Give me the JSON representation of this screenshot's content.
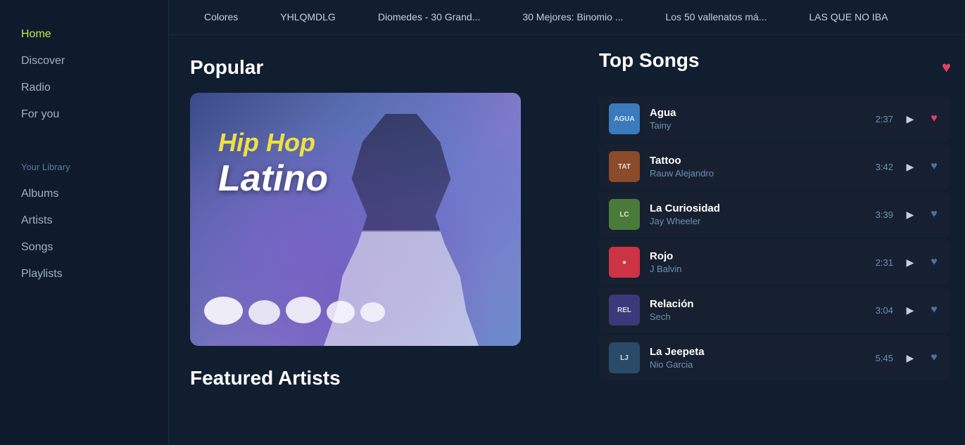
{
  "sidebar": {
    "nav": [
      {
        "label": "Home",
        "active": true
      },
      {
        "label": "Discover",
        "active": false
      },
      {
        "label": "Radio",
        "active": false
      },
      {
        "label": "For you",
        "active": false
      }
    ],
    "library_label": "Your Library",
    "library_items": [
      {
        "label": "Albums"
      },
      {
        "label": "Artists"
      },
      {
        "label": "Songs"
      },
      {
        "label": "Playlists"
      }
    ]
  },
  "topbar": {
    "items": [
      {
        "label": "Colores"
      },
      {
        "label": "YHLQMDLG"
      },
      {
        "label": "Diomedes - 30 Grand..."
      },
      {
        "label": "30 Mejores: Binomio ..."
      },
      {
        "label": "Los 50 vallenatos má..."
      },
      {
        "label": "LAS QUE NO IBA"
      }
    ]
  },
  "popular": {
    "title": "Popular",
    "genre_line1": "Hip Hop",
    "genre_line2": "Latino"
  },
  "featured": {
    "title": "Featured Artists"
  },
  "top_songs": {
    "title": "Top Songs",
    "songs": [
      {
        "name": "Agua",
        "artist": "Tainy",
        "duration": "2:37",
        "liked": true,
        "thumb_color": "#3a7abd",
        "thumb_label": "AGUA"
      },
      {
        "name": "Tattoo",
        "artist": "Rauw Alejandro",
        "duration": "3:42",
        "liked": false,
        "thumb_color": "#8b4a2a",
        "thumb_label": "TAT"
      },
      {
        "name": "La Curiosidad",
        "artist": "Jay Wheeler",
        "duration": "3:39",
        "liked": false,
        "thumb_color": "#4a7a3a",
        "thumb_label": "LC"
      },
      {
        "name": "Rojo",
        "artist": "J Balvin",
        "duration": "2:31",
        "liked": false,
        "thumb_color": "#cc3344",
        "thumb_label": "●"
      },
      {
        "name": "Relación",
        "artist": "Sech",
        "duration": "3:04",
        "liked": false,
        "thumb_color": "#3a3a7a",
        "thumb_label": "REL"
      },
      {
        "name": "La Jeepeta",
        "artist": "Nio Garcia",
        "duration": "5:45",
        "liked": false,
        "thumb_color": "#2a4a6a",
        "thumb_label": "LJ"
      }
    ]
  }
}
